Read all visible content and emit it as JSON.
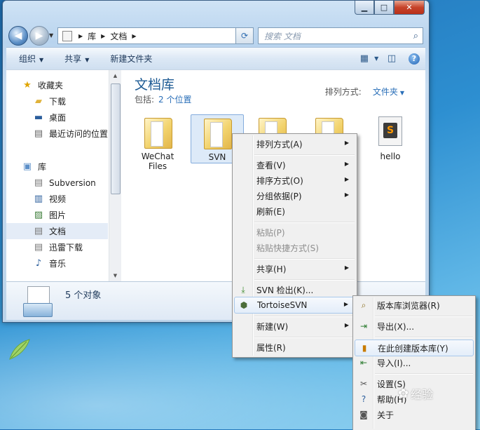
{
  "window": {
    "caption_buttons": {
      "minimize": "▁",
      "maximize": "□",
      "close": "✕"
    }
  },
  "nav": {
    "back_glyph": "◀",
    "forward_glyph": "▶",
    "breadcrumbs": [
      "库",
      "文档"
    ],
    "search_placeholder": "搜索 文档"
  },
  "toolbar": {
    "organize": "组织",
    "share": "共享",
    "new_folder": "新建文件夹"
  },
  "sidebar": {
    "favorites": {
      "label": "收藏夹",
      "items": [
        "下载",
        "桌面",
        "最近访问的位置"
      ]
    },
    "libraries": {
      "label": "库",
      "items": [
        "Subversion",
        "视频",
        "图片",
        "文档",
        "迅雷下载",
        "音乐"
      ],
      "selected": "文档"
    }
  },
  "content": {
    "title": "文档库",
    "includes_label": "包括:",
    "includes_link": "2 个位置",
    "arrange_label": "排列方式:",
    "arrange_value": "文件夹",
    "items": [
      {
        "name": "WeChat Files",
        "line1": "WeChat",
        "line2": "Files",
        "type": "folder"
      },
      {
        "name": "SVN",
        "type": "folder",
        "selected": true
      },
      {
        "name": "",
        "type": "folder"
      },
      {
        "name": "",
        "type": "folder"
      },
      {
        "name": "hello",
        "type": "sublime-file"
      }
    ]
  },
  "details": {
    "count": "5 个对象"
  },
  "context_menu": {
    "items": [
      {
        "label": "排列方式(A)",
        "submenu": true
      },
      {
        "label": "查看(V)",
        "submenu": true
      },
      {
        "label": "排序方式(O)",
        "submenu": true
      },
      {
        "label": "分组依据(P)",
        "submenu": true
      },
      {
        "label": "刷新(E)"
      },
      {
        "label": "粘贴(P)",
        "disabled": true
      },
      {
        "label": "粘贴快捷方式(S)",
        "disabled": true
      },
      {
        "label": "共享(H)",
        "submenu": true
      },
      {
        "label": "SVN 检出(K)...",
        "icon": "svn-checkout-icon"
      },
      {
        "label": "TortoiseSVN",
        "submenu": true,
        "icon": "tortoise-icon",
        "highlighted": true
      },
      {
        "label": "新建(W)",
        "submenu": true
      },
      {
        "label": "属性(R)"
      }
    ]
  },
  "svn_submenu": {
    "items": [
      {
        "label": "版本库浏览器(R)",
        "icon": "repo-browser-icon"
      },
      {
        "label": "导出(X)...",
        "icon": "export-icon"
      },
      {
        "label": "在此创建版本库(Y)",
        "icon": "create-repo-icon",
        "highlighted": true
      },
      {
        "label": "导入(I)...",
        "icon": "import-icon"
      },
      {
        "label": "设置(S)",
        "icon": "settings-icon"
      },
      {
        "label": "帮助(H)",
        "icon": "help-icon"
      },
      {
        "label": "关于",
        "icon": "about-icon"
      }
    ]
  },
  "watermark": "经验"
}
